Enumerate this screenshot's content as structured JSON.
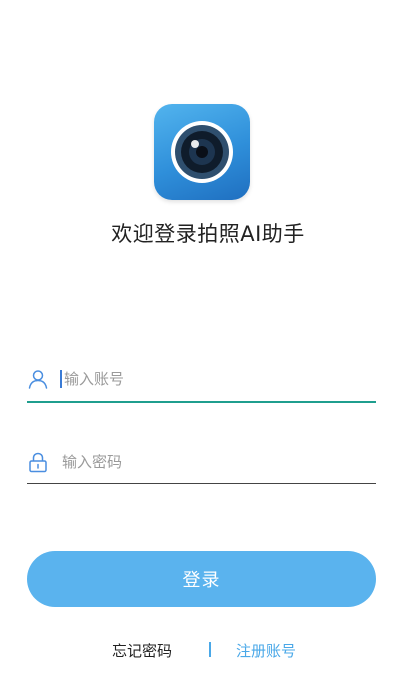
{
  "app": {
    "title": "欢迎登录拍照AI助手",
    "logo_icon": "camera-lens-icon"
  },
  "form": {
    "account": {
      "placeholder": "输入账号",
      "value": "",
      "icon": "user-icon"
    },
    "password": {
      "placeholder": "输入密码",
      "value": "",
      "icon": "lock-icon"
    },
    "login_label": "登录"
  },
  "links": {
    "forgot_label": "忘记密码",
    "register_label": "注册账号"
  },
  "colors": {
    "accent": "#5ab3ee",
    "focus_line": "#1f9e8e",
    "link": "#4aa8e8"
  }
}
